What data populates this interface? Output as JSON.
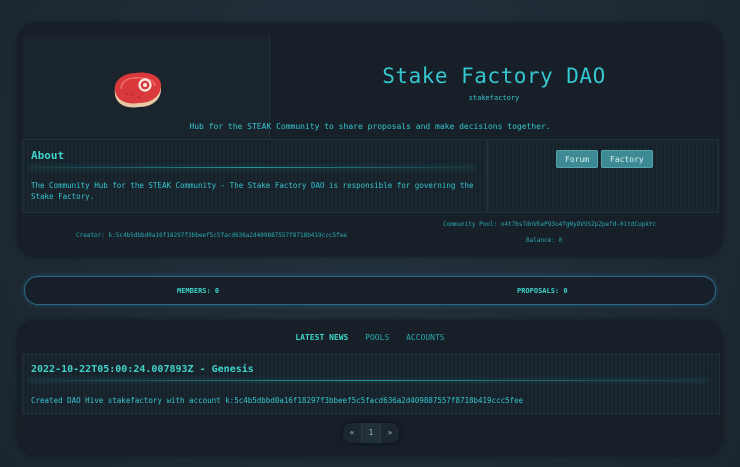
{
  "header": {
    "title": "Stake Factory DAO",
    "slug": "stakefactory",
    "tagline": "Hub for the STEAK Community to share proposals and make decisions together.",
    "logo_icon": "steak-icon"
  },
  "about": {
    "title": "About",
    "text": "The Community Hub for the STEAK Community - The Stake Factory DAO is responsible for governing the Stake Factory."
  },
  "buttons": {
    "forum": "Forum",
    "factory": "Factory"
  },
  "meta": {
    "creator": "Creator: k:5c4b5dbbd0a16f18297f3bbeef5c5facd636a2d409887557f8718b419ccc5fee",
    "pool": "Community Pool: o4t7bsTdnVEeP93o4fgNyDVVSZpZpefd-0itdCupkYc",
    "balance": "Balance: 0"
  },
  "stats": {
    "members": "MEMBERS: 0",
    "proposals": "PROPOSALS: 0"
  },
  "tabs": [
    {
      "label": "LATEST NEWS"
    },
    {
      "label": "POOLS"
    },
    {
      "label": "ACCOUNTS"
    }
  ],
  "news": {
    "title": "2022-10-22T05:00:24.007893Z - Genesis",
    "body": "Created DAO Hive stakefactory with account k:5c4b5dbbd0a16f18297f3bbeef5c5facd636a2d409887557f8718b419ccc5fee"
  },
  "pagination": {
    "prev": "«",
    "page": "1",
    "next": "»"
  },
  "colors": {
    "accent": "#35c6cf",
    "button": "#3e8a94",
    "card": "#172029"
  }
}
